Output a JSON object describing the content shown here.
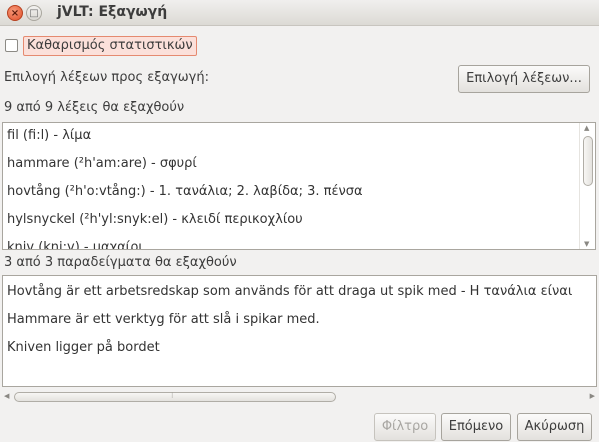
{
  "window": {
    "title": "jVLT: Εξαγωγή",
    "close_glyph": "×",
    "maximize_glyph": "□"
  },
  "clear_stats": {
    "label": "Καθαρισμός στατιστικών",
    "checked": false
  },
  "word_selection": {
    "label": "Επιλογή λέξεων προς εξαγωγή:",
    "button_label": "Επιλογή λέξεων...",
    "count_label": "9 από 9 λέξεις θα εξαχθούν"
  },
  "words": [
    "fil (fi:l) - λίμα",
    "hammare  (²h'am:are) - σφυρί",
    "hovtång (²h'o:vtång:) - 1. τανάλια; 2. λαβίδα; 3. πένσα",
    "hylsnyckel  (²h'yl:snyk:el) - κλειδί περικοχλίου",
    "kniv (kni:v) - μαχαίρι"
  ],
  "examples": {
    "count_label": "3 από 3 παραδείγματα θα εξαχθούν",
    "items": [
      "Hovtång är ett arbetsredskap som används för att draga ut spik med - Η τανάλια είναι",
      "Hammare är ett verktyg för att slå i spikar med.",
      "Kniven ligger på bordet"
    ]
  },
  "buttons": {
    "filter": "Φίλτρο",
    "next": "Επόμενο",
    "cancel": "Ακύρωση"
  },
  "scroll": {
    "up_arrow": "▲",
    "down_arrow": "▼",
    "left_arrow": "◀",
    "right_arrow": "▶",
    "grip": "⁝"
  }
}
